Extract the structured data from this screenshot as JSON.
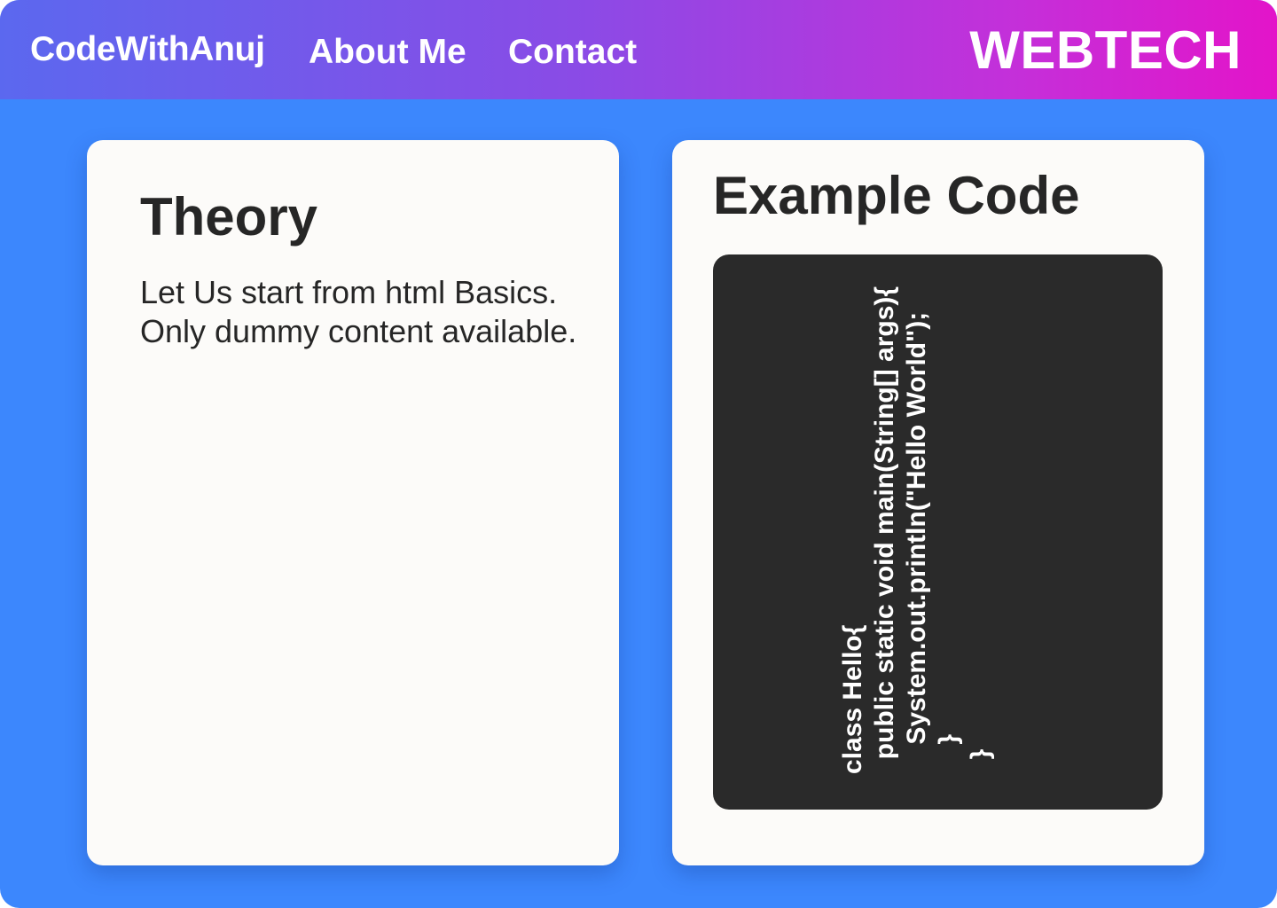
{
  "nav": {
    "brand": "CodeWithAnuj",
    "links": [
      "About Me",
      "Contact"
    ],
    "logo": "WEBTECH"
  },
  "theory": {
    "title": "Theory",
    "lines": [
      "Let Us start from html Basics.",
      "Only dummy content available."
    ]
  },
  "example": {
    "title": "Example Code",
    "code_lines": [
      "class Hello{",
      "  public static void main(String[] args){",
      "    System.out.println(\"Hello World\");",
      "    }",
      "  }"
    ]
  },
  "colors": {
    "page_background": "#3c87fd",
    "navbar_gradient_start": "#5b68ef",
    "navbar_gradient_end": "#e314c9",
    "card_background": "#fcfbf9",
    "code_background": "#2a2a2a",
    "text_dark": "#262626"
  }
}
